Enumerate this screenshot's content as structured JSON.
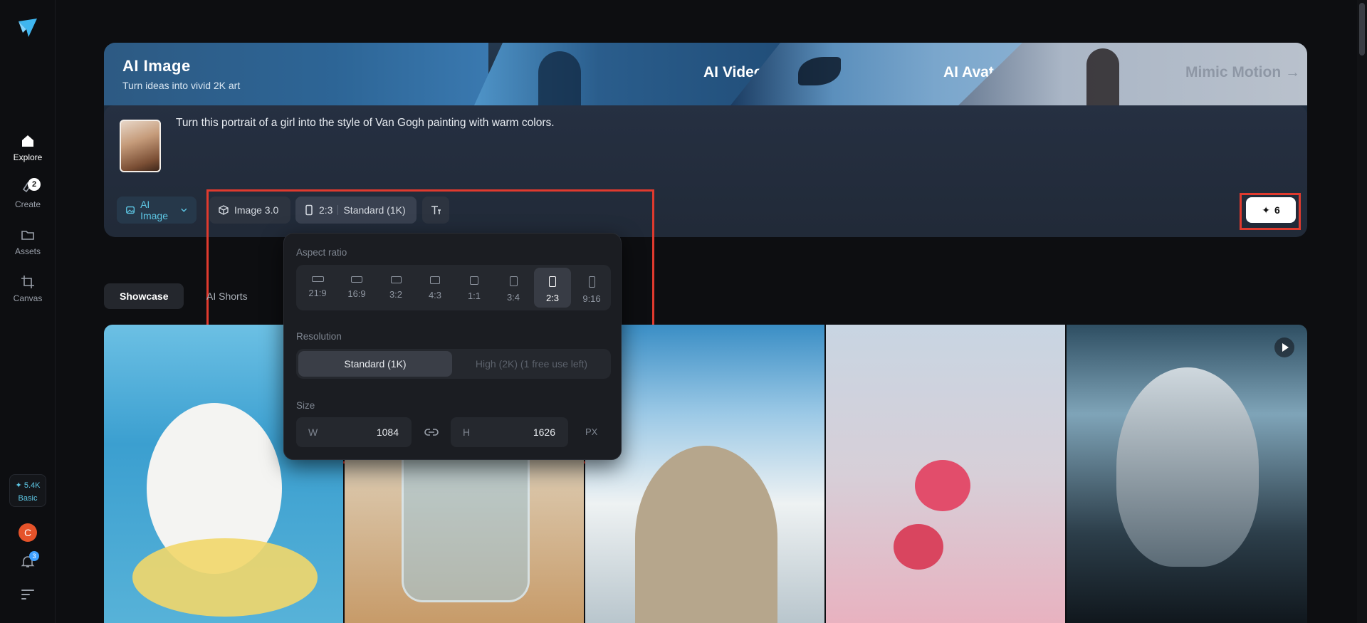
{
  "sidebar": {
    "items": [
      {
        "label": "Explore"
      },
      {
        "label": "Create",
        "badge": "2"
      },
      {
        "label": "Assets"
      },
      {
        "label": "Canvas"
      }
    ],
    "credits": {
      "amount": "✦ 5.4K",
      "plan": "Basic"
    },
    "avatar_initial": "C",
    "notifications": "3"
  },
  "hero": {
    "title": "AI Image",
    "subtitle": "Turn ideas into vivid 2K art",
    "tabs": [
      {
        "label": "AI Video →"
      },
      {
        "label": "AI Avatar →"
      },
      {
        "label": "Mimic Motion →"
      }
    ]
  },
  "prompt": {
    "text": "Turn this portrait of a girl into the style of Van Gogh painting with warm colors."
  },
  "toolbar": {
    "mode": "AI Image",
    "model": "Image 3.0",
    "ratio": "2:3",
    "quality": "Standard (1K)",
    "generate_cost": "6"
  },
  "popover": {
    "aspect_label": "Aspect ratio",
    "ratios": [
      "21:9",
      "16:9",
      "3:2",
      "4:3",
      "1:1",
      "3:4",
      "2:3",
      "9:16"
    ],
    "selected_ratio": "2:3",
    "resolution_label": "Resolution",
    "resolution_options": [
      "Standard (1K)",
      "High (2K)  (1 free use left)"
    ],
    "size_label": "Size",
    "width_key": "W",
    "width": "1084",
    "height_key": "H",
    "height": "1626",
    "unit": "PX"
  },
  "showcase": {
    "tabs": [
      "Showcase",
      "AI Shorts"
    ]
  },
  "colors": {
    "accent": "#5ec8e6",
    "highlight": "#e03a2e"
  }
}
